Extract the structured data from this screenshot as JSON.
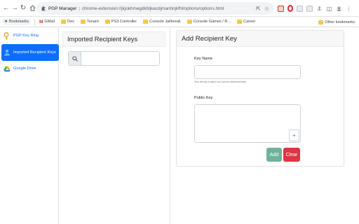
{
  "browser": {
    "site_name": "PGP Manager",
    "url": "chrome-extension://jkjokhmegdkbljkacdjmanbnjkfhl/options/options.html",
    "bookmarks": [
      {
        "label": "Bookmarks",
        "icon": "star-icon"
      },
      {
        "label": "GMail",
        "icon": "gmail-icon"
      },
      {
        "label": "Dev",
        "icon": "folder-icon"
      },
      {
        "label": "Tenant",
        "icon": "folder-icon"
      },
      {
        "label": "PS3 Controller",
        "icon": "folder-icon"
      },
      {
        "label": "Console Jailbreak",
        "icon": "folder-icon"
      },
      {
        "label": "Console Games / R...",
        "icon": "folder-icon"
      },
      {
        "label": "Career",
        "icon": "folder-icon"
      }
    ],
    "other_bookmarks": "Other bookmarks",
    "gmail_glyph": "M"
  },
  "sidebar": {
    "items": [
      {
        "label": "PGP Key Ring",
        "icon": "key-icon",
        "active": false
      },
      {
        "label": "Imported Recipient Keys",
        "icon": "user-icon",
        "active": true
      },
      {
        "label": "Google Drive",
        "icon": "google-drive-icon",
        "active": false
      }
    ]
  },
  "left_panel": {
    "title": "Imported Recipient Keys",
    "search_placeholder": ""
  },
  "form": {
    "title": "Add Recipient Key",
    "key_name_label": "Key Name",
    "key_name_hint": "Give the key a name so it can be referenced later",
    "public_key_label": "Public Key",
    "plus_label": "+",
    "add_label": "Add",
    "clear_label": "Clear"
  },
  "colors": {
    "primary": "#0d6efd",
    "add_button": "#6fb39a",
    "clear_button": "#dc3545"
  }
}
